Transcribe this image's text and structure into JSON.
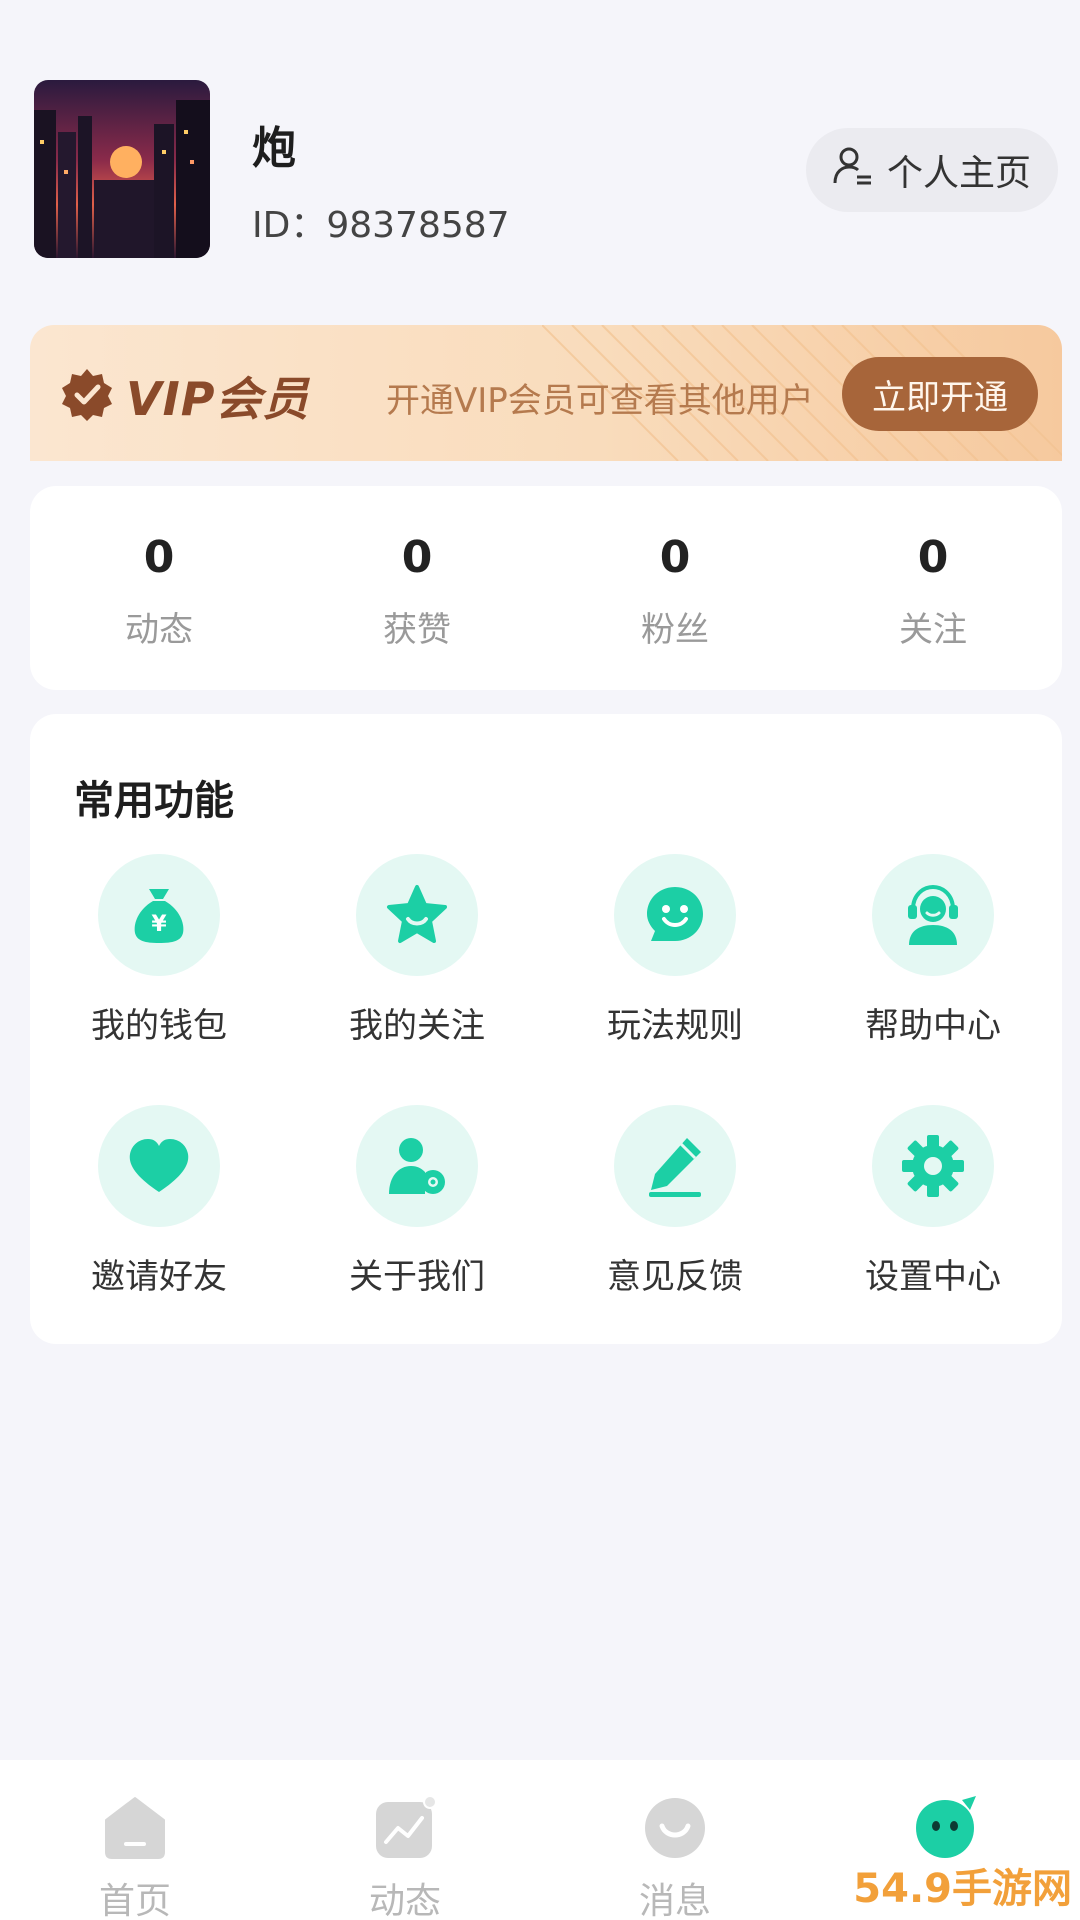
{
  "profile": {
    "name": "炮",
    "id_text": "ID：98378587",
    "homepage_label": "个人主页"
  },
  "vip": {
    "title": "VIP会员",
    "description": "开通VIP会员可查看其他用户",
    "button_label": "立即开通",
    "colors": {
      "button": "#a7653a",
      "title": "#8a4a2a"
    }
  },
  "stats": [
    {
      "value": "0",
      "label": "动态"
    },
    {
      "value": "0",
      "label": "获赞"
    },
    {
      "value": "0",
      "label": "粉丝"
    },
    {
      "value": "0",
      "label": "关注"
    }
  ],
  "features": {
    "title": "常用功能",
    "items": [
      {
        "label": "我的钱包",
        "icon": "wallet-icon"
      },
      {
        "label": "我的关注",
        "icon": "star-icon"
      },
      {
        "label": "玩法规则",
        "icon": "smile-chat-icon"
      },
      {
        "label": "帮助中心",
        "icon": "headset-icon"
      },
      {
        "label": "邀请好友",
        "icon": "heart-icon"
      },
      {
        "label": "关于我们",
        "icon": "user-gear-icon"
      },
      {
        "label": "意见反馈",
        "icon": "pencil-icon"
      },
      {
        "label": "设置中心",
        "icon": "gear-icon"
      }
    ],
    "accent_color": "#1ccfa5"
  },
  "bottom_nav": [
    {
      "label": "首页",
      "icon": "home-icon"
    },
    {
      "label": "动态",
      "icon": "trend-icon"
    },
    {
      "label": "消息",
      "icon": "message-icon"
    },
    {
      "label": "",
      "icon": "mascot-icon"
    }
  ],
  "watermark": "54.9手游网"
}
